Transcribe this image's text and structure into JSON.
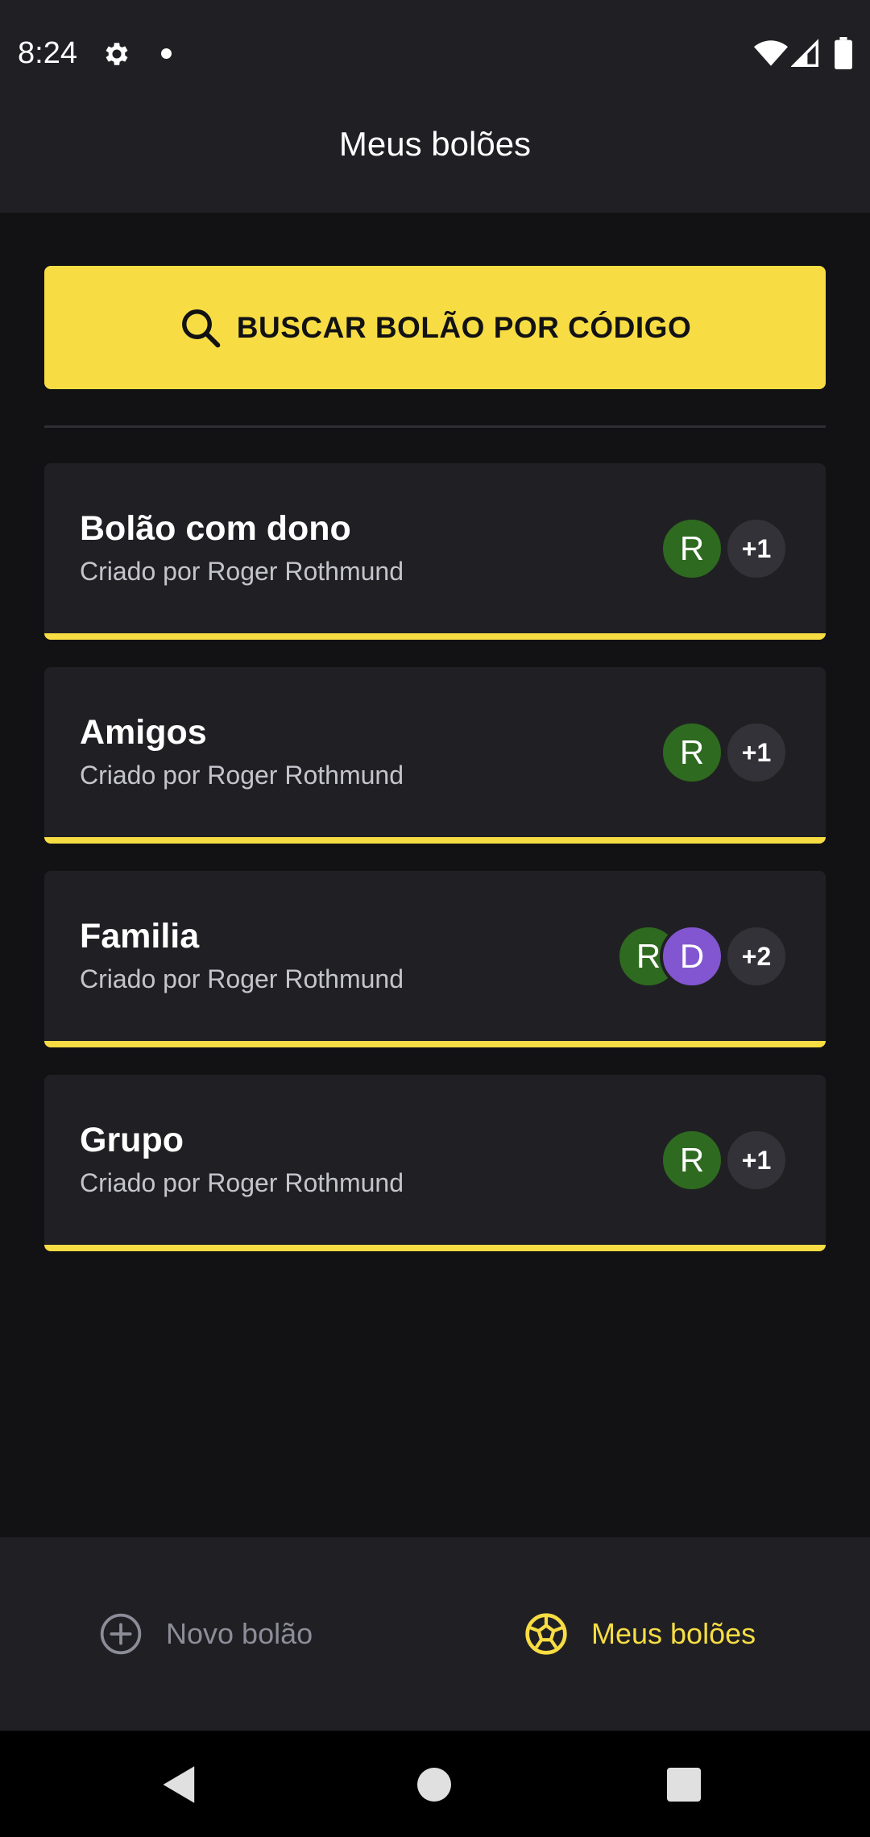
{
  "status_bar": {
    "time": "8:24"
  },
  "header": {
    "title": "Meus bolões"
  },
  "search": {
    "label": "BUSCAR BOLÃO POR CÓDIGO"
  },
  "pools": [
    {
      "name": "Bolão com dono",
      "owner": "Criado por Roger Rothmund",
      "avatars": [
        "R"
      ],
      "extra_count": "+1"
    },
    {
      "name": "Amigos",
      "owner": "Criado por Roger Rothmund",
      "avatars": [
        "R"
      ],
      "extra_count": "+1"
    },
    {
      "name": "Familia",
      "owner": "Criado por Roger Rothmund",
      "avatars": [
        "R",
        "D"
      ],
      "extra_count": "+2"
    },
    {
      "name": "Grupo",
      "owner": "Criado por Roger Rothmund",
      "avatars": [
        "R"
      ],
      "extra_count": "+1"
    }
  ],
  "bottom_nav": {
    "new_pool": "Novo bolão",
    "my_pools": "Meus bolões"
  },
  "colors": {
    "accent": "#F7DD43",
    "background": "#121214",
    "surface": "#202024",
    "avatar_green": "#2E6A1F",
    "avatar_purple": "#8256D0"
  },
  "icons": {
    "search": "search-icon",
    "new_pool": "plus-circle-icon",
    "my_pools": "soccer-ball-icon"
  }
}
